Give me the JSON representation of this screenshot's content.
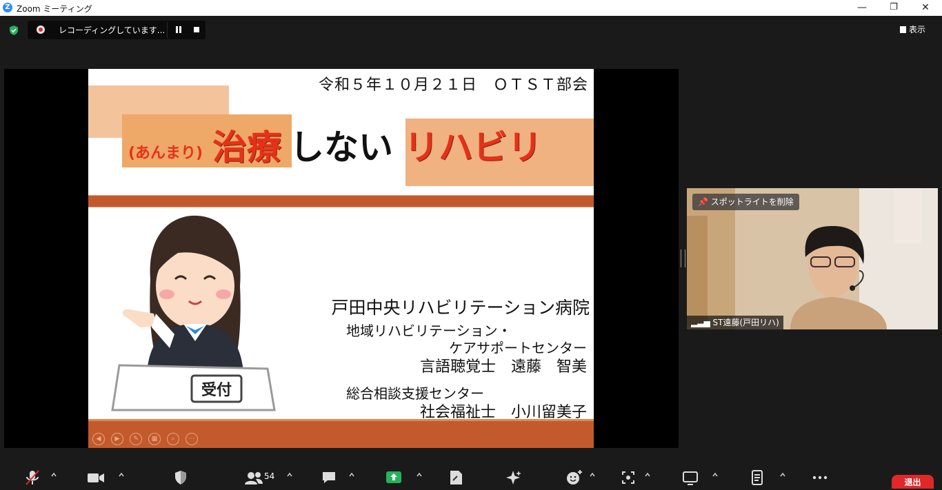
{
  "window": {
    "title": "Zoom ミーティング",
    "minimize": "—",
    "restore": "❐",
    "close": "✕"
  },
  "meeting_header": {
    "recording_label": "レコーディングしています...",
    "view_button": "表示"
  },
  "slide": {
    "date_line": "令和５年１０月２１日　ＯＴＳＴ部会",
    "title_prefix": "(あんまり)",
    "title_part1": "治療",
    "title_part2": "しない",
    "title_part3": "リハビリ",
    "sign_text": "受付",
    "hospital": "戸田中央リハビリテーション病院",
    "dept_line1": "地域リハビリテーション・",
    "dept_line2": "ケアサポートセンター",
    "speaker1": "言語聴覚士　遠藤　智美",
    "center": "総合相談支援センター",
    "speaker2": "社会福祉士　小川留美子"
  },
  "video_tile": {
    "spotlight_button": "スポットライトを削除",
    "participant_name": "ST遠藤(戸田リハ)"
  },
  "toolbar": {
    "participants_count": "54",
    "leave_button": "退出"
  },
  "colors": {
    "accent_orange": "#f0b280",
    "slide_band": "#c35a2e",
    "title_red": "#e83018",
    "leave_red": "#e02828",
    "share_green": "#22b45a"
  },
  "icons": [
    "shield-check-icon",
    "record-icon",
    "pause-icon",
    "stop-icon",
    "view-icon",
    "mic-muted-icon",
    "video-icon",
    "security-icon",
    "participants-icon",
    "chat-icon",
    "share-screen-icon",
    "notes-icon",
    "ai-companion-icon",
    "reactions-icon",
    "apps-icon",
    "whiteboard-icon",
    "docs-icon",
    "more-icon",
    "pin-icon",
    "signal-icon"
  ]
}
